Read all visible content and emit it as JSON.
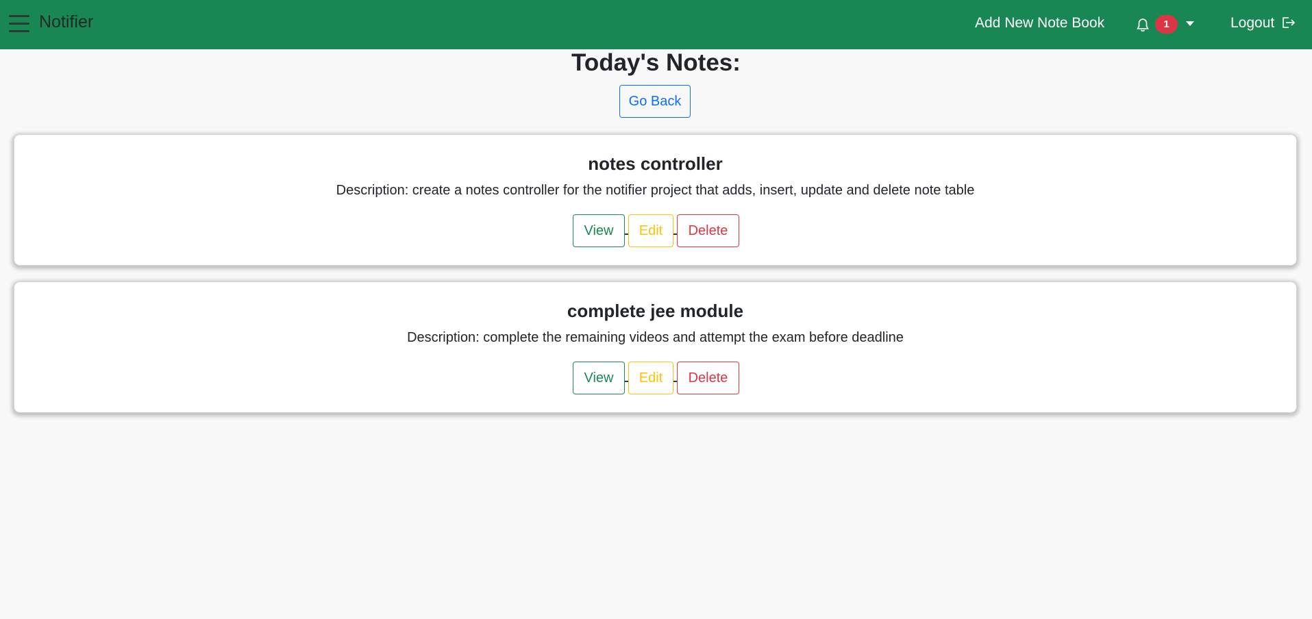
{
  "navbar": {
    "brand": "Notifier",
    "add_notebook": "Add New Note Book",
    "notification_count": "1",
    "logout": "Logout",
    "background_color": "#198754"
  },
  "main": {
    "title": "Today's Notes:",
    "go_back": "Go Back"
  },
  "notes": [
    {
      "title": "notes controller",
      "description": "Description: create a notes controller for the notifier project that adds, insert, update and delete note table",
      "view_label": "View",
      "edit_label": "Edit",
      "delete_label": "Delete"
    },
    {
      "title": "complete jee module",
      "description": "Description: complete the remaining videos and attempt the exam before deadline",
      "view_label": "View",
      "edit_label": "Edit",
      "delete_label": "Delete"
    }
  ],
  "colors": {
    "success": "#198754",
    "warning": "#ffc107",
    "danger": "#dc3545",
    "primary": "#0d6efd"
  }
}
